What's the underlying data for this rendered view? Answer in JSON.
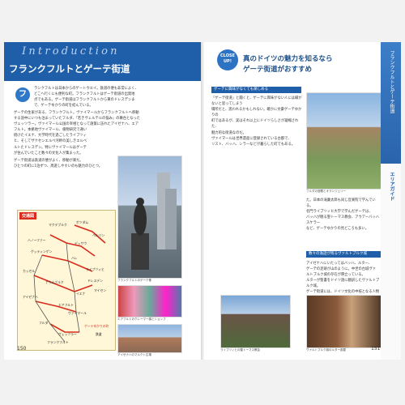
{
  "left": {
    "intro": "Introduction",
    "title": "フランクフルトとゲーテ街道",
    "badge": "フ",
    "para1": [
      "ランクフルトは日本からのゲートウエイ。鉄道の便も非常によく、",
      "どこへ行くにも便利な町。フランクフルトはゲーテ街道の出発地",
      "点でもある。ゲーテ街道はフランクフルトから東のドレスデンま",
      "で、ゲーテゆかりの町を結んでいる。"
    ],
    "para2": [
      "ゲーテの生家がある、フランクフルト。ヴァイマールからフランクフルトへ移動",
      "する途中にいつも泊まっていたフルダ、『若きヴェルテルの悩み』の舞台となった",
      "ヴェッツラー。ヴァイマール公国の宰相となって施策に訪れたアイゼナハ、エア",
      "フルト。本拠地ヴァイマール、植物研究で通い",
      "続けたイエナ、大学時代を過ごしたライプツィ",
      "ヒ、そしてザクセンエルベ河畔の美しきエルベ",
      "ルトたドレスデン。特にヴァイマールはゲーテ",
      "が住んでいたこと数々の文化人が集まった。"
    ],
    "para3": [
      "ゲーテ街道は鉄道の便がよく、移動が楽だ。",
      "ひとつの町に1泊ずつ、周遊しやすいのも魅力のひとつ。"
    ],
    "map": {
      "title": "交通図",
      "stations": [
        "マクデブルク",
        "ポツダム",
        "ベルリン",
        "デッサウ",
        "ハノーファー",
        "ゲッティンゲン",
        "ハレ",
        "ライプツィヒ",
        "カッセル",
        "ナウムブルク",
        "ドレスデン",
        "アイゼナハ",
        "エアフルト",
        "イエナ",
        "ヴァイマール",
        "フルダ",
        "マイセン",
        "ヴェッツラー",
        "フランクフルト",
        "ゲーテゆかりの町"
      ],
      "legend": "鉄道"
    },
    "captions": [
      "フランクフルトのゲーテ像",
      "エアフルトのクレーマー橋とショップ",
      "アイゼナハのマルクト広場"
    ],
    "page_number": "150"
  },
  "right": {
    "close_up": [
      "CLOSE",
      "UP!"
    ],
    "title": [
      "真のドイツの魅力を知るなら",
      "ゲーテ街道がおすすめ"
    ],
    "subhead1": "ゲーテに興味がなくても楽しめる",
    "col1": [
      "「ゲーテ街道」と聞くと、ゲーテに興味がない人には縁がないと思ってしまう",
      "場所だと、思われるかもしれない。確かに文豪ゲーテゆかりの",
      "町ではあるが、実はそれ以上にドイツらしさが凝縮された、",
      "魅力的な街道なのだ。",
      "ヴァイマールは世界遺産に登録されている古都で、",
      "リスト、バッハ、シラーなどが暮らした町でもある。"
    ],
    "col2": [
      "た。日本の滝廉太郎も同じ音楽院で学んでいる。",
      "名門ライプツィヒ大学で学んだゲーテは、",
      "バッハが眠る聖トーマス教会、アウアーバッハスケラー",
      "など、ゲーテゆかりの見どころも多い。"
    ],
    "subhead2": "数々の逸話が残るヴァルトブルク城",
    "col3": [
      "アイゼナハにいたってはバッハ、ルター、",
      "ゲーテの足跡が山のように。中世の古城ヴァ",
      "ルトブルク城の存在が際立っている。",
      "ルターが聖書をドイツ語に翻訳したヴァルトブルク城。",
      "ゲーテ街道には、ドイツ文化の中核となる人物の足跡が多く残っている。"
    ],
    "captions": [
      "フルダの宮殿とオランジェリー",
      "ライプツィヒの聖トーマス教会",
      "ヴァルトブルク城のルター部屋"
    ],
    "side_label": "フランクフルトとゲーテ街道",
    "side_guide": "エリアガイド",
    "page_number": "151"
  },
  "colors": {
    "accent": "#1f5ea8",
    "red_route": "#d92b1e"
  }
}
